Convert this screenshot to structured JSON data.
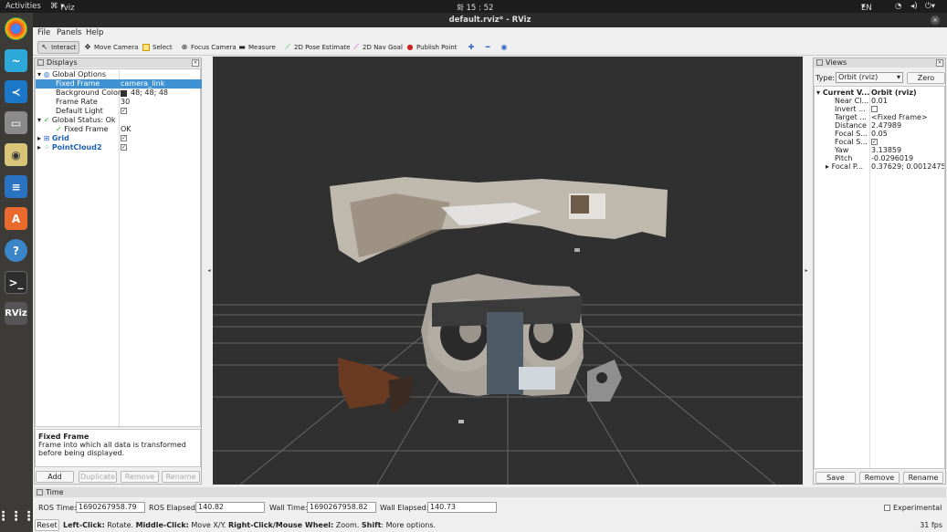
{
  "topbar": {
    "activities": "Activities",
    "app": "rviz",
    "clock": "화 15 : 52",
    "lang": "EN"
  },
  "window": {
    "title": "default.rviz* - RViz"
  },
  "menu": {
    "file": "File",
    "panels": "Panels",
    "help": "Help"
  },
  "toolbar": {
    "interact": "Interact",
    "move_camera": "Move Camera",
    "select": "Select",
    "focus_camera": "Focus Camera",
    "measure": "Measure",
    "pose_estimate": "2D Pose Estimate",
    "nav_goal": "2D Nav Goal",
    "publish_point": "Publish Point"
  },
  "displays": {
    "title": "Displays",
    "rows": [
      {
        "label": "Global Options",
        "value": ""
      },
      {
        "label": "Fixed Frame",
        "value": "camera_link"
      },
      {
        "label": "Background Color",
        "value": "48; 48; 48"
      },
      {
        "label": "Frame Rate",
        "value": "30"
      },
      {
        "label": "Default Light",
        "value": "✓"
      },
      {
        "label": "Global Status: Ok",
        "value": ""
      },
      {
        "label": "Fixed Frame",
        "value": "OK"
      },
      {
        "label": "Grid",
        "value": "✓"
      },
      {
        "label": "PointCloud2",
        "value": "✓"
      }
    ],
    "help_title": "Fixed Frame",
    "help_text": "Frame into which all data is transformed before being displayed.",
    "buttons": {
      "add": "Add",
      "duplicate": "Duplicate",
      "remove": "Remove",
      "rename": "Rename"
    }
  },
  "views": {
    "title": "Views",
    "type_label": "Type:",
    "type_value": "Orbit (rviz)",
    "zero": "Zero",
    "rows": [
      {
        "label": "Current V...",
        "value": "Orbit (rviz)"
      },
      {
        "label": "Near Cl...",
        "value": "0.01"
      },
      {
        "label": "Invert ...",
        "value": ""
      },
      {
        "label": "Target ...",
        "value": "<Fixed Frame>"
      },
      {
        "label": "Distance",
        "value": "2.47989"
      },
      {
        "label": "Focal S...",
        "value": "0.05"
      },
      {
        "label": "Focal S...",
        "value": "✓"
      },
      {
        "label": "Yaw",
        "value": "3.13859"
      },
      {
        "label": "Pitch",
        "value": "-0.0296019"
      },
      {
        "label": "Focal P...",
        "value": "0.37629; 0.0012475..."
      }
    ],
    "buttons": {
      "save": "Save",
      "remove": "Remove",
      "rename": "Rename"
    }
  },
  "time": {
    "title": "Time",
    "ros_time_label": "ROS Time:",
    "ros_time": "1690267958.79",
    "ros_elapsed_label": "ROS Elapsed:",
    "ros_elapsed": "140.82",
    "wall_time_label": "Wall Time:",
    "wall_time": "1690267958.82",
    "wall_elapsed_label": "Wall Elapsed:",
    "wall_elapsed": "140.73",
    "experimental": "Experimental"
  },
  "status": {
    "reset": "Reset",
    "k1": "Left-Click:",
    "v1": " Rotate. ",
    "k2": "Middle-Click:",
    "v2": " Move X/Y. ",
    "k3": "Right-Click/Mouse Wheel:",
    "v3": " Zoom. ",
    "k4": "Shift",
    "v4": ": More options.",
    "fps": "31 fps"
  }
}
